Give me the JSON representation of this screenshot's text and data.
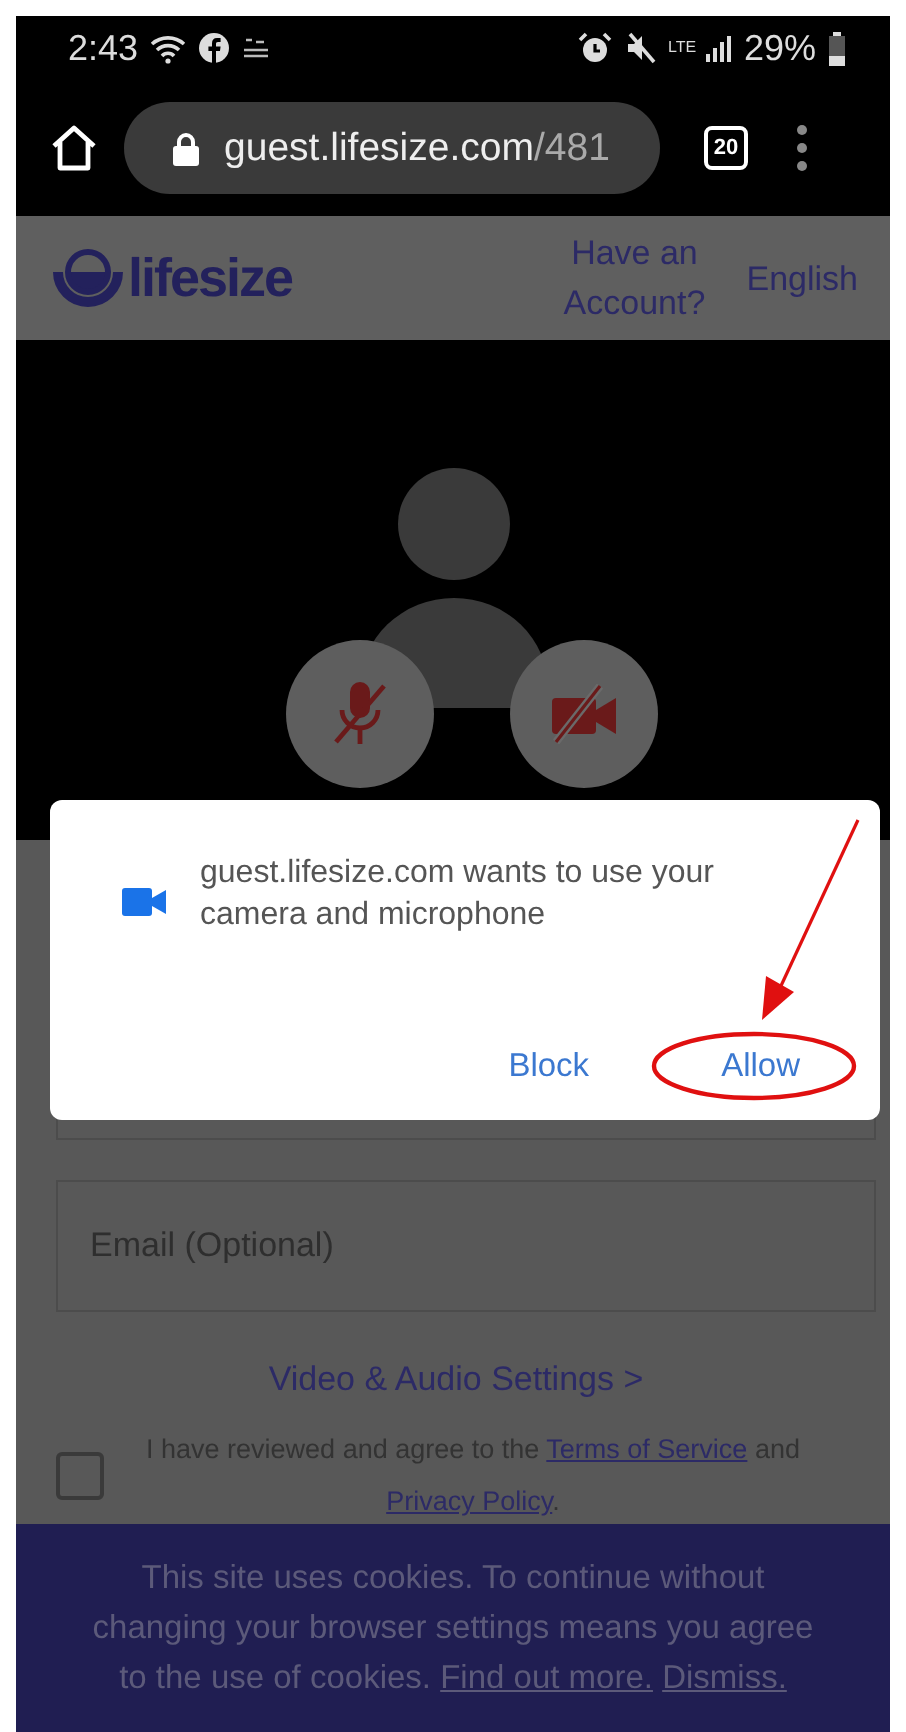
{
  "status_bar": {
    "time": "2:43",
    "network": "LTE",
    "battery": "29%"
  },
  "browser": {
    "url_host": "guest.lifesize.com",
    "url_path": "/481",
    "tab_count": "20"
  },
  "header": {
    "logo": "lifesize",
    "links": [
      "Have an Account?",
      "English"
    ]
  },
  "video": {
    "mic_muted": true,
    "camera_muted": true
  },
  "dialog": {
    "message": "guest.lifesize.com wants to use your camera and microphone",
    "buttons": [
      {
        "label": "Block",
        "highlighted": false
      },
      {
        "label": "Allow",
        "highlighted": true
      }
    ]
  },
  "form": {
    "email_placeholder": "Email (Optional)",
    "settings_link": "Video & Audio Settings >",
    "agree": {
      "checked": false,
      "text_before": "I have reviewed and agree to the ",
      "terms_link": "Terms of Service",
      "text_middle": " and ",
      "privacy_link": "Privacy Policy",
      "text_after": "."
    }
  },
  "cookie_banner": {
    "message": "This site uses cookies. To continue without changing your browser settings means you agree to the use of cookies.",
    "links": [
      "Find out more.",
      "Dismiss."
    ]
  }
}
